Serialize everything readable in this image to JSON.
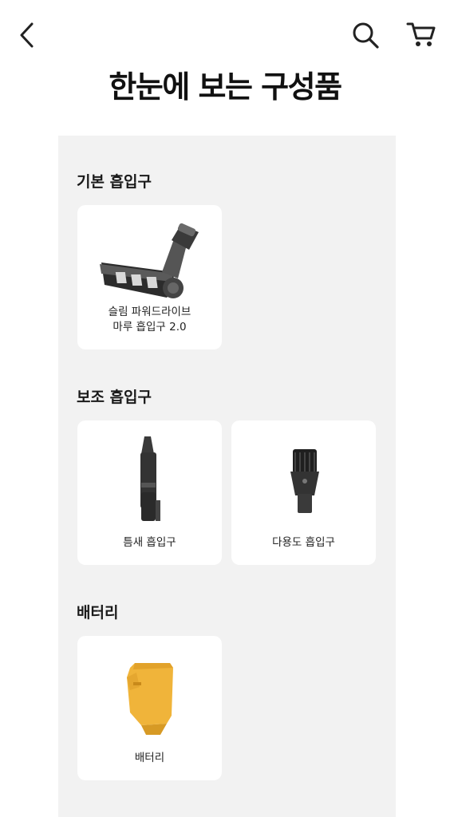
{
  "header": {
    "back_icon": "chevron-left-icon",
    "search_icon": "search-icon",
    "cart_icon": "cart-icon",
    "title": "한눈에 보는 구성품"
  },
  "sections": [
    {
      "title": "기본 흡입구",
      "items": [
        {
          "label": "슬림 파워드라이브\n마루 흡입구 2.0",
          "icon": "floor-brush-icon"
        }
      ]
    },
    {
      "title": "보조 흡입구",
      "items": [
        {
          "label": "틈새 흡입구",
          "icon": "crevice-tool-icon"
        },
        {
          "label": "다용도 흡입구",
          "icon": "multi-tool-icon"
        }
      ]
    },
    {
      "title": "배터리",
      "items": [
        {
          "label": "배터리",
          "icon": "battery-icon"
        }
      ]
    }
  ],
  "colors": {
    "panel_bg": "#f2f2f2",
    "card_bg": "#ffffff",
    "battery": "#f0b43a"
  }
}
